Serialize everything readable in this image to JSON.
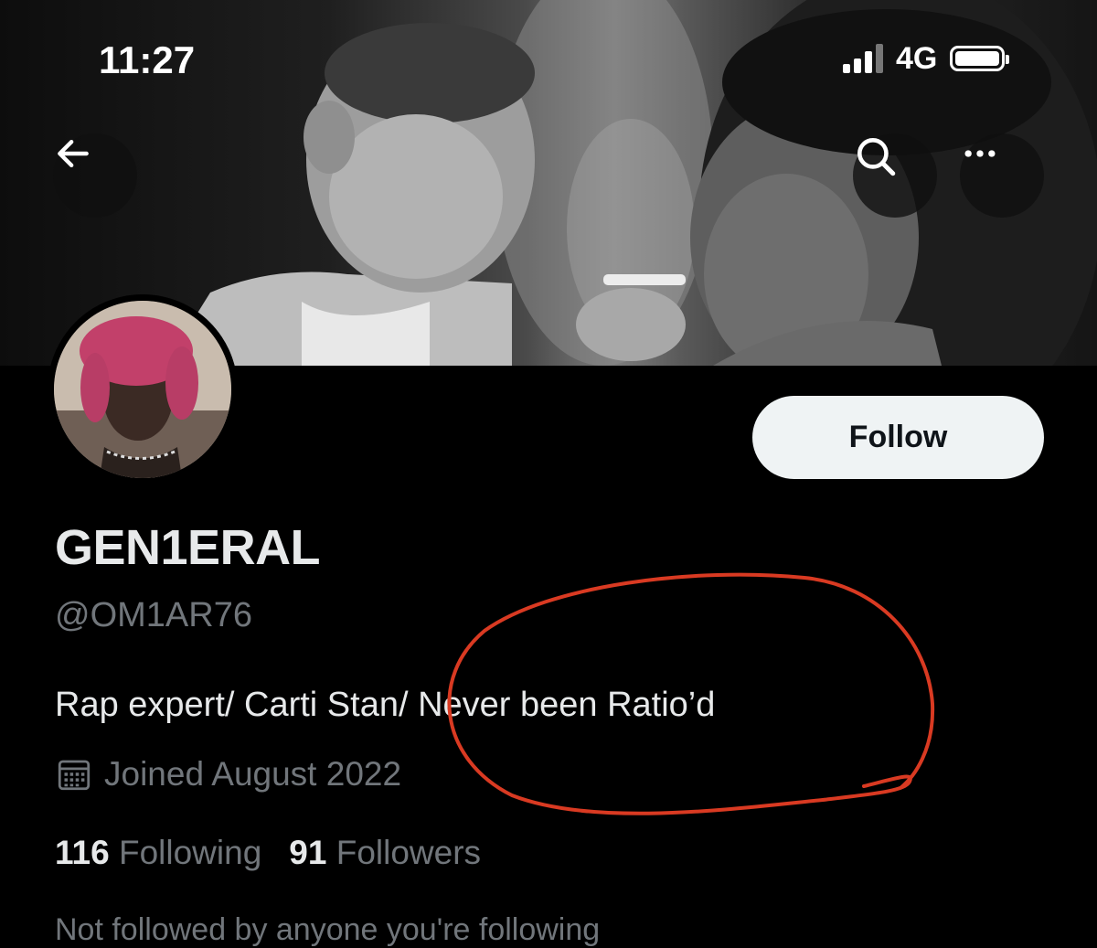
{
  "status_bar": {
    "time": "11:27",
    "network": "4G",
    "signal_bars": 3,
    "signal_bars_total": 4,
    "battery_level": 1.0
  },
  "header": {
    "back_icon": "arrow-left-icon",
    "search_icon": "search-icon",
    "more_icon": "more-horizontal-icon",
    "follow_label": "Follow"
  },
  "profile": {
    "display_name": "GEN1ERAL",
    "handle": "@OM1AR76",
    "bio": "Rap expert/ Carti Stan/ Never been Ratio’d",
    "joined_icon": "calendar-icon",
    "joined": "Joined August 2022",
    "following_count": "116",
    "following_label": "Following",
    "followers_count": "91",
    "followers_label": "Followers",
    "followed_by_text": "Not followed by anyone you're following"
  },
  "colors": {
    "background": "#000000",
    "primary_text": "#e7e9ea",
    "secondary_text": "#71767b",
    "follow_button_bg": "#eff3f4",
    "annotation_red": "#d93a22"
  }
}
